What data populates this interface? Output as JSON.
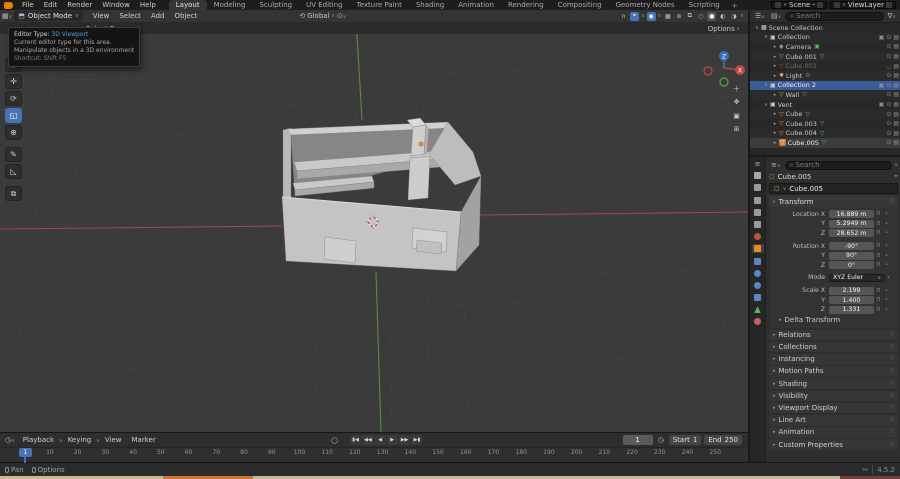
{
  "topbar": {
    "menus": [
      "File",
      "Edit",
      "Render",
      "Window",
      "Help"
    ],
    "tabs": [
      "Layout",
      "Modeling",
      "Sculpting",
      "UV Editing",
      "Texture Paint",
      "Shading",
      "Animation",
      "Rendering",
      "Compositing",
      "Geometry Nodes",
      "Scripting"
    ],
    "active_tab": "Layout",
    "new_tab": "+",
    "scene_label": "Scene",
    "viewlayer_label": "ViewLayer"
  },
  "viewport": {
    "mode": "Object Mode",
    "menus": [
      "View",
      "Select",
      "Add",
      "Object"
    ],
    "orientation": "Global",
    "tool_label": "Select Box",
    "options_label": "Options",
    "tooltip": {
      "title_label": "Editor Type:",
      "title_value": "3D Viewport",
      "line1": "Current editor type for this area.",
      "line2": "Manipulate objects in a 3D environment",
      "shortcut": "Shortcut: Shift F5"
    },
    "toolbar_tools": [
      "tweak-select",
      "move",
      "rotate",
      "scale",
      "transform",
      "annotate",
      "measure",
      "add-cube"
    ],
    "active_tool": "scale",
    "nav_buttons": [
      "zoom",
      "pan",
      "camera",
      "perspective-grid"
    ],
    "axis_labels": {
      "x": "X",
      "z": "Z"
    }
  },
  "outliner": {
    "search_placeholder": "Search",
    "items": [
      {
        "label": "Scene Collection",
        "type": "scene-collection",
        "level": 0,
        "expander": "open",
        "controls": ""
      },
      {
        "label": "Collection",
        "type": "collection",
        "level": 1,
        "expander": "open",
        "controls": "cec"
      },
      {
        "label": "Camera",
        "type": "camera",
        "level": 2,
        "expander": "closed",
        "badge": "camera-data",
        "controls": "ec"
      },
      {
        "label": "Cube.001",
        "type": "mesh",
        "level": 2,
        "expander": "closed",
        "badge": "mesh-data",
        "controls": "ec"
      },
      {
        "label": "Cube.002",
        "type": "mesh",
        "level": 2,
        "expander": "closed",
        "dimmed": true,
        "eye": "closed",
        "controls": "ec"
      },
      {
        "label": "Light",
        "type": "light",
        "level": 2,
        "expander": "closed",
        "badge": "light-data",
        "controls": "ec"
      },
      {
        "label": "Collection 2",
        "type": "collection",
        "level": 1,
        "expander": "open",
        "selected": true,
        "controls": "cec"
      },
      {
        "label": "Wall",
        "type": "mesh",
        "level": 2,
        "expander": "closed",
        "badge": "mesh-data",
        "controls": "ec"
      },
      {
        "label": "Vent",
        "type": "collection",
        "level": 1,
        "expander": "open",
        "controls": "cec"
      },
      {
        "label": "Cube",
        "type": "mesh",
        "level": 2,
        "expander": "closed",
        "badge": "mesh-data",
        "controls": "ec"
      },
      {
        "label": "Cube.003",
        "type": "mesh",
        "level": 2,
        "expander": "closed",
        "badge": "mesh-data",
        "controls": "ec"
      },
      {
        "label": "Cube.004",
        "type": "mesh",
        "level": 2,
        "expander": "closed",
        "badge": "mesh-data",
        "controls": "ec"
      },
      {
        "label": "Cube.005",
        "type": "mesh",
        "level": 2,
        "expander": "closed",
        "badge": "mesh-data",
        "controls": "ec",
        "active": true
      }
    ]
  },
  "properties": {
    "search_placeholder": "Search",
    "breadcrumb_object": "Cube.005",
    "name_value": "Cube.005",
    "tabs": [
      "tool",
      "render",
      "output",
      "view-layer",
      "scene",
      "world",
      "object",
      "modifiers",
      "particles",
      "physics",
      "constraints",
      "data",
      "material"
    ],
    "active_tab": "object",
    "transform_title": "Transform",
    "location_rows": [
      {
        "label": "Location X",
        "value": "16.889 m"
      },
      {
        "label": "Y",
        "value": "5.2949 m"
      },
      {
        "label": "Z",
        "value": "28.652 m"
      }
    ],
    "rotation_rows": [
      {
        "label": "Rotation X",
        "value": "-90°"
      },
      {
        "label": "Y",
        "value": "90°"
      },
      {
        "label": "Z",
        "value": "0°"
      }
    ],
    "mode_label": "Mode",
    "mode_value": "XYZ Euler",
    "scale_rows": [
      {
        "label": "Scale X",
        "value": "2.199"
      },
      {
        "label": "Y",
        "value": "1.400"
      },
      {
        "label": "Z",
        "value": "1.331"
      }
    ],
    "delta_label": "Delta Transform",
    "sections": [
      "Relations",
      "Collections",
      "Instancing",
      "Motion Paths",
      "Shading",
      "Visibility",
      "Viewport Display",
      "Line Art",
      "Animation",
      "Custom Properties"
    ]
  },
  "timeline": {
    "menus": [
      "Playback",
      "Keying",
      "View",
      "Marker"
    ],
    "playback_buttons": [
      "jump-start",
      "prev-keyframe",
      "play-reverse",
      "play",
      "next-keyframe",
      "jump-end"
    ],
    "current_frame": "1",
    "start_label": "Start",
    "start_value": "1",
    "end_label": "End",
    "end_value": "250",
    "ticks": [
      "10",
      "20",
      "30",
      "40",
      "50",
      "60",
      "70",
      "80",
      "90",
      "100",
      "110",
      "120",
      "130",
      "140",
      "150",
      "160",
      "170",
      "180",
      "190",
      "200",
      "210",
      "220",
      "230",
      "240",
      "250"
    ]
  },
  "statusbar": {
    "pan_label": "Pan",
    "options_label": "Options",
    "version": "4.5.2"
  },
  "colors": {
    "accent": "#4772b3",
    "selection": "#3b5b98",
    "object_orange": "#e0933c",
    "data_green": "#57b857"
  }
}
